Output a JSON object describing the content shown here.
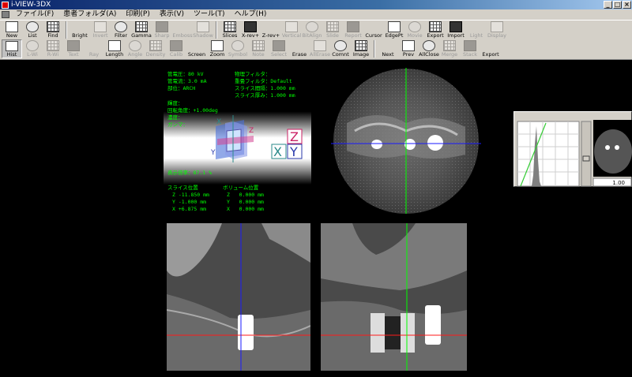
{
  "window": {
    "title": "i-VIEW-3DX"
  },
  "menu": [
    "ファイル(F)",
    "患者フォルダ(A)",
    "印刷(P)",
    "表示(V)",
    "ツール(T)",
    "ヘルプ(H)"
  ],
  "toolbar1": [
    {
      "label": "New",
      "icon": "new-icon",
      "enabled": true
    },
    {
      "label": "List",
      "icon": "list-icon",
      "enabled": true
    },
    {
      "label": "Find",
      "icon": "find-icon",
      "enabled": true
    },
    {
      "sep": true
    },
    {
      "label": "Bright",
      "icon": "bright-icon",
      "enabled": true
    },
    {
      "label": "Invert",
      "icon": "invert-icon",
      "enabled": false
    },
    {
      "label": "Filter",
      "icon": "filter-icon",
      "enabled": true
    },
    {
      "label": "Gamma",
      "icon": "gamma-icon",
      "enabled": true
    },
    {
      "label": "Sharp",
      "icon": "sharp-icon",
      "enabled": false
    },
    {
      "label": "Emboss",
      "icon": "emboss-icon",
      "enabled": false
    },
    {
      "label": "Shadow",
      "icon": "shadow-icon",
      "enabled": false
    },
    {
      "sep": true
    },
    {
      "label": "Slices",
      "icon": "slices-icon",
      "enabled": true
    },
    {
      "label": "X-rev+",
      "icon": "x-rev-icon",
      "enabled": true
    },
    {
      "label": "Z-rev+",
      "icon": "z-rev-icon",
      "enabled": true
    },
    {
      "label": "Vertical",
      "icon": "vertical-icon",
      "enabled": false
    },
    {
      "label": "BitAlign",
      "icon": "bitalign-icon",
      "enabled": false
    },
    {
      "label": "Slide",
      "icon": "slide-icon",
      "enabled": false
    },
    {
      "label": "Report",
      "icon": "report-icon",
      "enabled": false
    },
    {
      "label": "Cursor",
      "icon": "cursor-icon",
      "enabled": true
    },
    {
      "label": "EdgePt",
      "icon": "edgept-icon",
      "enabled": true
    },
    {
      "label": "Movie",
      "icon": "movie-icon",
      "enabled": false
    },
    {
      "label": "Export",
      "icon": "export-icon",
      "enabled": true
    },
    {
      "label": "Import",
      "icon": "import-icon",
      "enabled": true
    },
    {
      "label": "Light",
      "icon": "light-icon",
      "enabled": false
    },
    {
      "label": "Display",
      "icon": "display-icon",
      "enabled": false
    }
  ],
  "toolbar2": [
    {
      "label": "Hist",
      "icon": "hist-icon",
      "enabled": true,
      "pressed": true
    },
    {
      "label": "L-Wi",
      "icon": "lwi-icon",
      "enabled": false
    },
    {
      "label": "R-Wi",
      "icon": "rwi-icon",
      "enabled": false
    },
    {
      "label": "Text",
      "icon": "text-icon",
      "enabled": false
    },
    {
      "label": "Ray",
      "icon": "ray-icon",
      "enabled": false
    },
    {
      "label": "Length",
      "icon": "length-icon",
      "enabled": true
    },
    {
      "label": "Angle",
      "icon": "angle-icon",
      "enabled": false
    },
    {
      "label": "Density",
      "icon": "density-icon",
      "enabled": false
    },
    {
      "label": "Calib",
      "icon": "calib-icon",
      "enabled": false
    },
    {
      "label": "Screen",
      "icon": "screen-icon",
      "enabled": true
    },
    {
      "label": "Zoom",
      "icon": "zoom-icon",
      "enabled": true
    },
    {
      "label": "Symbol",
      "icon": "symbol-icon",
      "enabled": false
    },
    {
      "label": "Note",
      "icon": "note-icon",
      "enabled": false
    },
    {
      "label": "Select",
      "icon": "select-icon",
      "enabled": false
    },
    {
      "label": "Erase",
      "icon": "erase-icon",
      "enabled": true
    },
    {
      "label": "AllErase",
      "icon": "allerase-icon",
      "enabled": false
    },
    {
      "label": "Comnt",
      "icon": "comment-icon",
      "enabled": true
    },
    {
      "label": "Image",
      "icon": "image-icon",
      "enabled": true
    },
    {
      "sep": true
    },
    {
      "label": "Next",
      "icon": "next-icon",
      "enabled": true
    },
    {
      "label": "Prev",
      "icon": "prev-icon",
      "enabled": true
    },
    {
      "label": "AllClose",
      "icon": "allclose-icon",
      "enabled": true
    },
    {
      "label": "Merge",
      "icon": "merge-icon",
      "enabled": false
    },
    {
      "label": "Stack",
      "icon": "stack-icon",
      "enabled": false
    },
    {
      "label": "Export",
      "icon": "export2-icon",
      "enabled": true
    }
  ],
  "info": {
    "tube_voltage": "管電圧：80 kV",
    "tube_current": "管電流：3.0 mA",
    "region": "部位：ARCH",
    "phys_filter": "物理フィルタ：",
    "recon_filter": "重畳フィルタ：Default",
    "slice_interval": "スライス間隔：1.000 mm",
    "slice_thickness": "スライス厚み：1.000 mm",
    "brightness": "輝度：",
    "rotation": "回転角度：+1.00deg",
    "contrast": "濃度：",
    "gamma": "ガンマ：",
    "zoom": "表示倍率：87.1 %",
    "slice_pos_label": "スライス位置",
    "volume_pos_label": "ボリューム位置",
    "z_slice": "Z -11.850 mm",
    "y_slice": "Y -1.000 mm",
    "x_slice": "X +6.875 mm",
    "z_vol": "Z   0.000 mm",
    "y_vol": "Y   0.000 mm",
    "x_vol": "X   0.000 mm"
  },
  "axis_labels": {
    "x": "X",
    "y": "Y",
    "z": "Z"
  },
  "histogram": {
    "value": "1.00"
  },
  "colors": {
    "green": "#00ff00",
    "blue": "#1a1aff",
    "red": "#ff1a1a",
    "axis_z": "#cc2266",
    "axis_x": "#2a8a8a"
  }
}
